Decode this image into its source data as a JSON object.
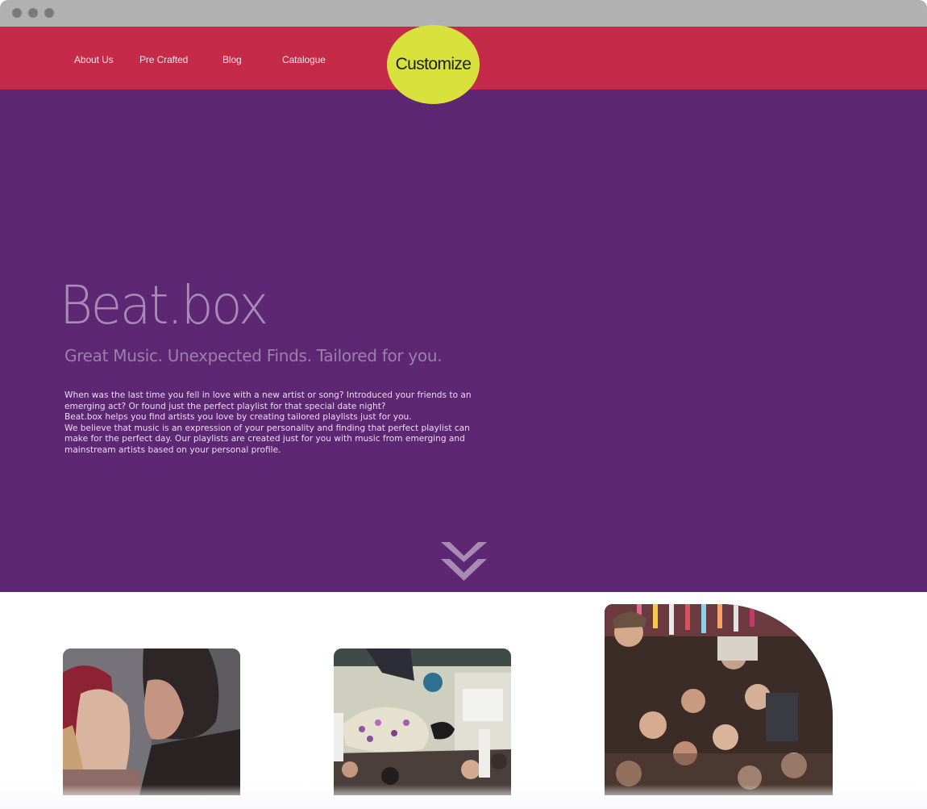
{
  "browser": {
    "controls": [
      "close",
      "minimize",
      "maximize"
    ]
  },
  "nav": {
    "links": [
      "About Us",
      "Pre Crafted",
      "Blog",
      "Catalogue"
    ],
    "cta_label": "Customize"
  },
  "hero": {
    "brand": "Beat.box",
    "tagline": "Great Music. Unexpected Finds. Tailored for you.",
    "paragraphs": [
      "When was the last time you fell in love with a new artist or song? Introduced your friends to an emerging act? Or found just the perfect playlist for that special date night?",
      "Beat.box helps you find artists you love by creating tailored playlists just for you.",
      "We believe that music is an expression of your personality and finding that perfect playlist can make for the perfect day. Our playlists are created just for you with music from emerging and mainstream artists based on your personal profile."
    ],
    "scroll_icon": "double-chevron-down-icon"
  },
  "cards": [
    {
      "name": "couple-photo",
      "icon": "photo-icon"
    },
    {
      "name": "crowd-surf-photo",
      "icon": "photo-icon"
    },
    {
      "name": "party-crowd-photo",
      "icon": "photo-icon"
    }
  ],
  "colors": {
    "chrome": "#b1b1b1",
    "nav_background": "#c52a49",
    "cta_background": "#d9e23d",
    "hero_background": "#5d2774",
    "brand_text": "#a98bb5",
    "tagline_text": "#9c80ab",
    "body_text": "#eadcef",
    "chevron": "#a78bb2"
  }
}
